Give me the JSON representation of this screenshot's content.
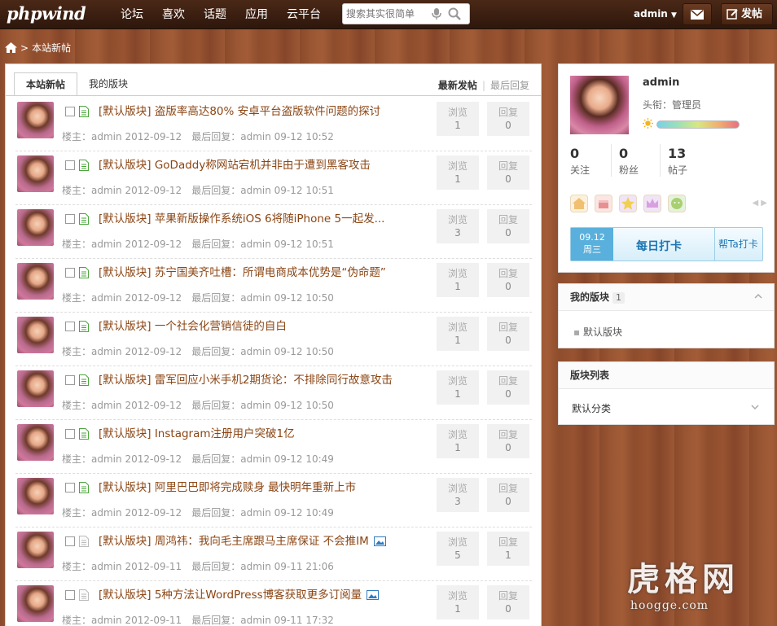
{
  "header": {
    "logo": "phpwind",
    "nav": [
      "论坛",
      "喜欢",
      "话题",
      "应用",
      "云平台"
    ],
    "search_placeholder": "搜索其实很简单",
    "user": "admin",
    "post_label": "发帖"
  },
  "breadcrumb": "本站新帖",
  "tabs": {
    "active": "本站新帖",
    "mine": "我的版块",
    "sort_latest": "最新发帖",
    "sort_reply": "最后回复"
  },
  "threads": [
    {
      "title": "[默认版块] 盗版率高达80% 安卓平台盗版软件问题的探讨",
      "author_label": "楼主：",
      "author": "admin",
      "date": "2012-09-12",
      "reply_label": "最后回复：",
      "last": "admin 09-12 10:52",
      "views_label": "浏览",
      "views": "1",
      "replies_label": "回复",
      "replies": "0"
    },
    {
      "title": "[默认版块] GoDaddy称网站宕机并非由于遭到黑客攻击",
      "author_label": "楼主：",
      "author": "admin",
      "date": "2012-09-12",
      "reply_label": "最后回复：",
      "last": "admin 09-12 10:51",
      "views_label": "浏览",
      "views": "1",
      "replies_label": "回复",
      "replies": "0"
    },
    {
      "title": "[默认版块] 苹果新版操作系统iOS 6将随iPhone 5一起发...",
      "author_label": "楼主：",
      "author": "admin",
      "date": "2012-09-12",
      "reply_label": "最后回复：",
      "last": "admin 09-12 10:51",
      "views_label": "浏览",
      "views": "3",
      "replies_label": "回复",
      "replies": "0"
    },
    {
      "title": "[默认版块] 苏宁国美齐吐槽：所谓电商成本优势是“伪命题”",
      "author_label": "楼主：",
      "author": "admin",
      "date": "2012-09-12",
      "reply_label": "最后回复：",
      "last": "admin 09-12 10:50",
      "views_label": "浏览",
      "views": "1",
      "replies_label": "回复",
      "replies": "0"
    },
    {
      "title": "[默认版块] 一个社会化营销信徒的自白",
      "author_label": "楼主：",
      "author": "admin",
      "date": "2012-09-12",
      "reply_label": "最后回复：",
      "last": "admin 09-12 10:50",
      "views_label": "浏览",
      "views": "1",
      "replies_label": "回复",
      "replies": "0"
    },
    {
      "title": "[默认版块] 雷军回应小米手机2期货论：不排除同行故意攻击",
      "author_label": "楼主：",
      "author": "admin",
      "date": "2012-09-12",
      "reply_label": "最后回复：",
      "last": "admin 09-12 10:50",
      "views_label": "浏览",
      "views": "1",
      "replies_label": "回复",
      "replies": "0"
    },
    {
      "title": "[默认版块] Instagram注册用户突破1亿",
      "author_label": "楼主：",
      "author": "admin",
      "date": "2012-09-12",
      "reply_label": "最后回复：",
      "last": "admin 09-12 10:49",
      "views_label": "浏览",
      "views": "1",
      "replies_label": "回复",
      "replies": "0"
    },
    {
      "title": "[默认版块] 阿里巴巴即将完成赎身 最快明年重新上市",
      "author_label": "楼主：",
      "author": "admin",
      "date": "2012-09-12",
      "reply_label": "最后回复：",
      "last": "admin 09-12 10:49",
      "views_label": "浏览",
      "views": "3",
      "replies_label": "回复",
      "replies": "0"
    },
    {
      "title": "[默认版块] 周鸿祎：我向毛主席跟马主席保证 不会推IM",
      "author_label": "楼主：",
      "author": "admin",
      "date": "2012-09-11",
      "reply_label": "最后回复：",
      "last": "admin 09-11 21:06",
      "views_label": "浏览",
      "views": "5",
      "replies_label": "回复",
      "replies": "1",
      "has_image": true
    },
    {
      "title": "[默认版块] 5种方法让WordPress博客获取更多订阅量",
      "author_label": "楼主：",
      "author": "admin",
      "date": "2012-09-11",
      "reply_label": "最后回复：",
      "last": "admin 09-11 17:32",
      "views_label": "浏览",
      "views": "1",
      "replies_label": "回复",
      "replies": "0",
      "has_image": true
    }
  ],
  "profile": {
    "name": "admin",
    "title": "头衔：管理员",
    "follow_count": "0",
    "follow_label": "关注",
    "fans_count": "0",
    "fans_label": "粉丝",
    "posts_count": "13",
    "posts_label": "帖子",
    "checkin_date": "09.12",
    "checkin_weekday": "周三",
    "checkin_label": "每日打卡",
    "checkin_help": "帮Ta打卡"
  },
  "my_forums": {
    "title": "我的版块",
    "count": "1",
    "items": [
      "默认版块"
    ]
  },
  "forum_list": {
    "title": "版块列表",
    "items": [
      "默认分类"
    ]
  },
  "watermark": {
    "line1": "虎格网",
    "line2": "hoogge.com"
  }
}
